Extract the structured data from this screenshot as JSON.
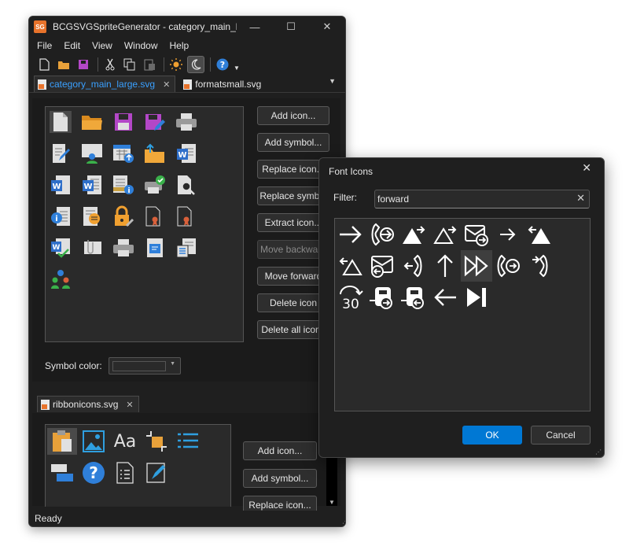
{
  "main_window": {
    "title": "BCGSVGSpriteGenerator - category_main_la...",
    "app_icon_text": "SG",
    "controls": {
      "minimize": "—",
      "maximize": "☐",
      "close": "✕"
    },
    "menu": [
      "File",
      "Edit",
      "View",
      "Window",
      "Help"
    ],
    "toolbar_icons": [
      "new-file-icon",
      "open-folder-icon",
      "save-icon",
      "cut-icon",
      "copy-icon",
      "paste-icon",
      "light-theme-icon",
      "dark-theme-icon",
      "help-icon",
      "dropdown-arrow-icon"
    ],
    "tabs": [
      {
        "label": "category_main_large.svg",
        "active": true,
        "close": "✕"
      },
      {
        "label": "formatsmall.svg",
        "active": false
      }
    ],
    "tab_dropdown": "▼",
    "top_panel": {
      "buttons": {
        "add_icon": "Add icon...",
        "add_symbol": "Add symbol...",
        "replace_icon": "Replace icon...",
        "replace_symbol": "Replace symbol",
        "extract_icon": "Extract icon...",
        "move_backward": "Move backward",
        "move_forward": "Move forward",
        "delete_icon": "Delete icon",
        "delete_all_icons": "Delete all icons"
      },
      "symbol_color_label": "Symbol color:",
      "icon_grid": [
        "document-icon",
        "folder-icon",
        "save-purple-icon",
        "save-edit-icon",
        "printer-icon",
        "edit-document-icon",
        "user-document-icon",
        "calendar-upload-icon",
        "folder-upload-icon",
        "word-document-icon",
        "word-icon",
        "word-document-2-icon",
        "server-info-icon",
        "printer-check-icon",
        "magnifier-document-icon",
        "info-document-icon",
        "document-list-icon",
        "lock-key-icon",
        "certificate-icon",
        "certificate-2-icon",
        "word-check-icon",
        "attachment-icon",
        "printer-2-icon",
        "blue-document-icon",
        "document-properties-icon",
        "users-icon"
      ]
    },
    "bottom_panel": {
      "tab": {
        "label": "ribbonicons.svg",
        "close": "✕"
      },
      "buttons": {
        "add_icon": "Add icon...",
        "add_symbol": "Add symbol...",
        "replace_icon": "Replace icon..."
      },
      "icon_grid": [
        "clipboard-icon",
        "picture-icon",
        "font-icon",
        "crop-icon",
        "list-icon",
        "layers-icon",
        "help-icon",
        "checklist-icon",
        "format-painter-icon"
      ]
    },
    "status": "Ready"
  },
  "dialog": {
    "title": "Font Icons",
    "close": "✕",
    "filter_label": "Filter:",
    "filter_value": "forward",
    "clear": "✕",
    "icons": [
      "arrow-right-icon",
      "phone-forward-icon",
      "triangle-forward-filled-icon",
      "triangle-forward-outline-icon",
      "mail-forward-icon",
      "arrow-right-small-icon",
      "triangle-back-filled-icon",
      "triangle-back-outline-icon",
      "mail-back-icon",
      "phone-hook-icon",
      "arrow-up-icon",
      "fast-forward-icon",
      "phone-forward-2-icon",
      "phone-2-icon",
      "redo-30-icon",
      "device-forward-icon",
      "device-back-icon",
      "arrow-left-icon",
      "skip-forward-icon"
    ],
    "selected_index": 11,
    "redo_label": "30",
    "ok": "OK",
    "cancel": "Cancel"
  },
  "colors": {
    "accent": "#0078d4",
    "tab_active": "#3aa0ff",
    "folder": "#e8a13a",
    "purple": "#b347c7",
    "word_blue": "#2f6fc9"
  }
}
